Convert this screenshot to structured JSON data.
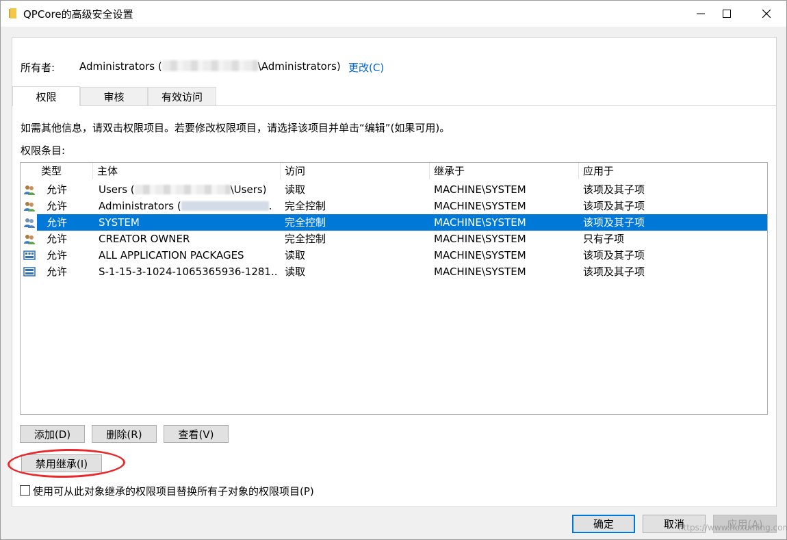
{
  "window": {
    "title": "QPCore的高级安全设置",
    "folder_icon": "folder-icon",
    "accent_color": "#0078d7"
  },
  "owner": {
    "label": "所有者:",
    "value_prefix": "Administrators (",
    "value_suffix": "\\Administrators)",
    "change_link": "更改(C)"
  },
  "tabs": [
    {
      "label": "权限",
      "active": true
    },
    {
      "label": "审核",
      "active": false
    },
    {
      "label": "有效访问",
      "active": false
    }
  ],
  "info_text": "如需其他信息，请双击权限项目。若要修改权限项目，请选择该项目并单击“编辑”(如果可用)。",
  "entries_label": "权限条目:",
  "columns": [
    "类型",
    "主体",
    "访问",
    "继承于",
    "应用于"
  ],
  "rows": [
    {
      "icon": "users-group-icon",
      "type": "允许",
      "principal": "Users (",
      "principal_suffix": "\\Users)",
      "access": "读取",
      "inherited_from": "MACHINE\\SYSTEM",
      "applies_to": "该项及其子项",
      "selected": false
    },
    {
      "icon": "users-group-icon",
      "type": "允许",
      "principal": "Administrators (",
      "principal_suffix": ".",
      "access": "完全控制",
      "inherited_from": "MACHINE\\SYSTEM",
      "applies_to": "该项及其子项",
      "selected": false
    },
    {
      "icon": "users-group-icon",
      "type": "允许",
      "principal": "SYSTEM",
      "principal_suffix": "",
      "access": "完全控制",
      "inherited_from": "MACHINE\\SYSTEM",
      "applies_to": "该项及其子项",
      "selected": true
    },
    {
      "icon": "users-group-icon",
      "type": "允许",
      "principal": "CREATOR OWNER",
      "principal_suffix": "",
      "access": "完全控制",
      "inherited_from": "MACHINE\\SYSTEM",
      "applies_to": "只有子项",
      "selected": false
    },
    {
      "icon": "app-package-icon",
      "type": "允许",
      "principal": "ALL APPLICATION PACKAGES",
      "principal_suffix": "",
      "access": "读取",
      "inherited_from": "MACHINE\\SYSTEM",
      "applies_to": "该项及其子项",
      "selected": false
    },
    {
      "icon": "app-package-icon",
      "type": "允许",
      "principal": "S-1-15-3-1024-1065365936-1281...",
      "principal_suffix": "",
      "access": "读取",
      "inherited_from": "MACHINE\\SYSTEM",
      "applies_to": "该项及其子项",
      "selected": false
    }
  ],
  "buttons": {
    "add": "添加(D)",
    "remove": "删除(R)",
    "view": "查看(V)",
    "disable_inheritance": "禁用继承(I)",
    "ok": "确定",
    "cancel": "取消",
    "apply": "应用(A)"
  },
  "replace_checkbox": {
    "label": "使用可从此对象继承的权限项目替换所有子对象的权限项目(P)",
    "checked": false
  },
  "annotation_color": "#e8282a",
  "watermark": "https://www.hoxuming.com"
}
